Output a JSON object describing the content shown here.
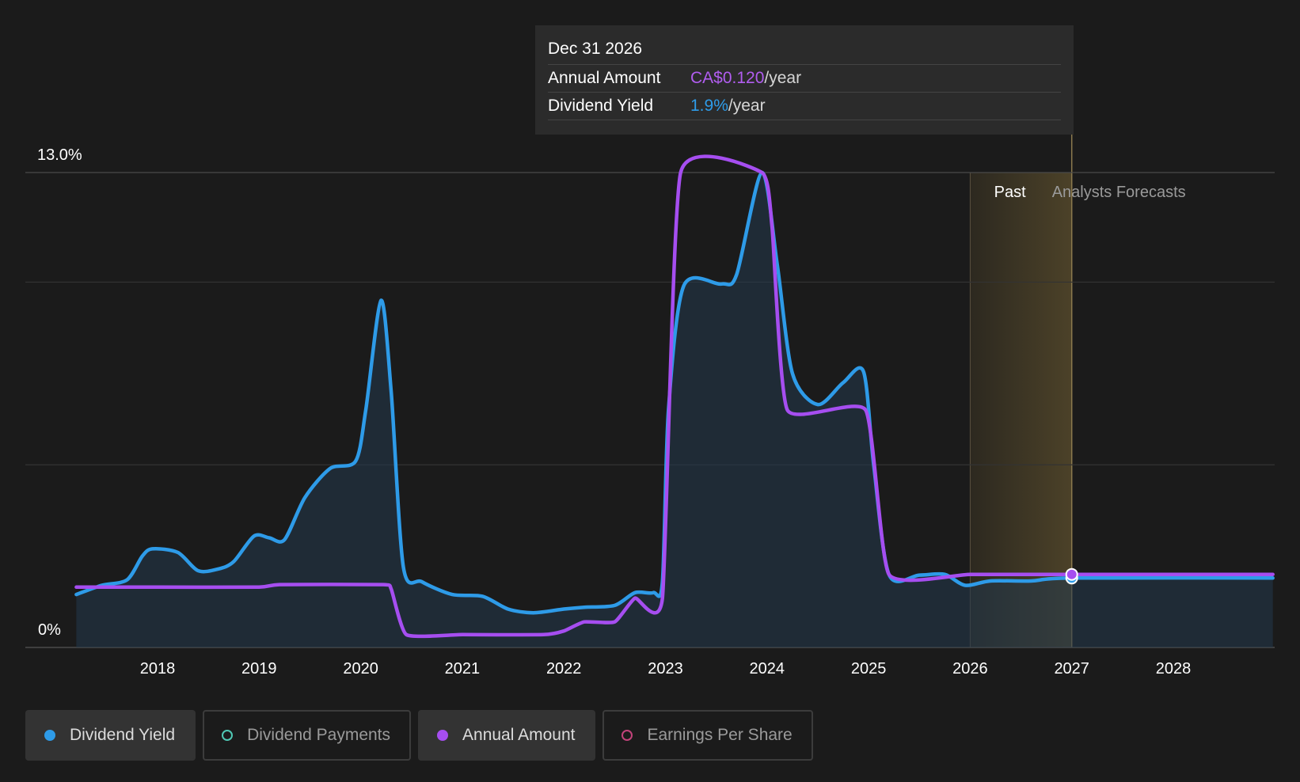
{
  "tooltip": {
    "date": "Dec 31 2026",
    "annual_amount_label": "Annual Amount",
    "annual_amount_value": "CA$0.120",
    "dividend_yield_label": "Dividend Yield",
    "dividend_yield_value": "1.9%",
    "unit": "/year"
  },
  "legend": {
    "dividend_yield": "Dividend Yield",
    "dividend_payments": "Dividend Payments",
    "annual_amount": "Annual Amount",
    "earnings_per_share": "Earnings Per Share"
  },
  "colors": {
    "yield": "#2e9be8",
    "annual": "#a64ef0",
    "payments": "#4fc8b4",
    "eps": "#c2437a",
    "forecast_band": "#c9a44a"
  },
  "chart_data": {
    "type": "line",
    "y_top_label": "13.0%",
    "y_bottom_label": "0%",
    "ylim": [
      0,
      13
    ],
    "xlim": [
      2017.2,
      2028.98
    ],
    "x_ticks": [
      "2018",
      "2019",
      "2020",
      "2021",
      "2022",
      "2023",
      "2024",
      "2025",
      "2026",
      "2027",
      "2028"
    ],
    "region_labels": {
      "past": "Past",
      "forecast": "Analysts Forecasts"
    },
    "forecast_band": [
      2026.0,
      2027.0
    ],
    "highlight_x": 2027.0,
    "series": [
      {
        "name": "Dividend Yield",
        "key": "yield",
        "points": [
          [
            2017.2,
            1.45
          ],
          [
            2017.45,
            1.7
          ],
          [
            2017.7,
            1.85
          ],
          [
            2017.85,
            2.5
          ],
          [
            2017.95,
            2.7
          ],
          [
            2018.2,
            2.6
          ],
          [
            2018.4,
            2.1
          ],
          [
            2018.6,
            2.15
          ],
          [
            2018.75,
            2.35
          ],
          [
            2018.95,
            3.05
          ],
          [
            2019.1,
            3.0
          ],
          [
            2019.25,
            2.95
          ],
          [
            2019.45,
            4.1
          ],
          [
            2019.7,
            4.9
          ],
          [
            2019.95,
            5.1
          ],
          [
            2020.05,
            6.5
          ],
          [
            2020.2,
            9.5
          ],
          [
            2020.3,
            7.0
          ],
          [
            2020.42,
            2.2
          ],
          [
            2020.6,
            1.8
          ],
          [
            2020.9,
            1.45
          ],
          [
            2021.2,
            1.4
          ],
          [
            2021.45,
            1.05
          ],
          [
            2021.7,
            0.95
          ],
          [
            2022.0,
            1.05
          ],
          [
            2022.2,
            1.1
          ],
          [
            2022.5,
            1.15
          ],
          [
            2022.7,
            1.5
          ],
          [
            2022.88,
            1.5
          ],
          [
            2022.97,
            1.8
          ],
          [
            2023.03,
            6.5
          ],
          [
            2023.18,
            9.9
          ],
          [
            2023.55,
            9.95
          ],
          [
            2023.7,
            10.2
          ],
          [
            2023.95,
            13.0
          ],
          [
            2024.1,
            10.5
          ],
          [
            2024.25,
            7.5
          ],
          [
            2024.5,
            6.65
          ],
          [
            2024.75,
            7.25
          ],
          [
            2024.95,
            7.55
          ],
          [
            2025.05,
            5.0
          ],
          [
            2025.2,
            2.0
          ],
          [
            2025.5,
            1.98
          ],
          [
            2025.75,
            2.0
          ],
          [
            2025.95,
            1.7
          ],
          [
            2026.2,
            1.82
          ],
          [
            2026.6,
            1.82
          ],
          [
            2027.0,
            1.9
          ],
          [
            2028.98,
            1.9
          ]
        ]
      },
      {
        "name": "Annual Amount",
        "key": "annual",
        "points": [
          [
            2017.2,
            1.65
          ],
          [
            2018.0,
            1.65
          ],
          [
            2019.0,
            1.65
          ],
          [
            2019.2,
            1.72
          ],
          [
            2020.22,
            1.72
          ],
          [
            2020.3,
            1.6
          ],
          [
            2020.45,
            0.35
          ],
          [
            2021.0,
            0.35
          ],
          [
            2021.8,
            0.35
          ],
          [
            2022.0,
            0.45
          ],
          [
            2022.2,
            0.7
          ],
          [
            2022.5,
            0.7
          ],
          [
            2022.7,
            1.35
          ],
          [
            2022.97,
            1.35
          ],
          [
            2023.15,
            13.0
          ],
          [
            2023.95,
            13.0
          ],
          [
            2024.05,
            11.5
          ],
          [
            2024.2,
            6.5
          ],
          [
            2024.97,
            6.5
          ],
          [
            2025.2,
            2.0
          ],
          [
            2026.0,
            2.0
          ],
          [
            2027.0,
            2.0
          ],
          [
            2028.98,
            2.0
          ]
        ]
      }
    ]
  }
}
